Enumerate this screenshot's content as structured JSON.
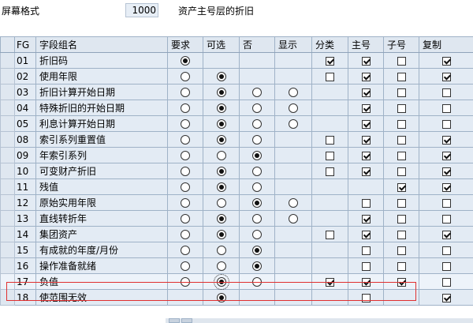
{
  "header": {
    "label": "屏幕格式",
    "value": "1000",
    "description": "资产主号层的折旧"
  },
  "columns": [
    "FG",
    "字段组名",
    "要求",
    "可选",
    "否",
    "显示",
    "分类",
    "主号",
    "子号",
    "复制"
  ],
  "rows": [
    {
      "fg": "01",
      "name": "折旧码",
      "radios": [
        "on",
        "",
        "",
        ""
      ],
      "checks": [
        "on",
        "on",
        "off",
        "on"
      ]
    },
    {
      "fg": "02",
      "name": "使用年限",
      "radios": [
        "off",
        "on",
        "",
        ""
      ],
      "checks": [
        "off",
        "on",
        "off",
        "on"
      ]
    },
    {
      "fg": "03",
      "name": "折旧计算开始日期",
      "radios": [
        "off",
        "on",
        "off",
        "off"
      ],
      "checks": [
        "",
        "on",
        "off",
        "off"
      ]
    },
    {
      "fg": "04",
      "name": "特殊折旧的开始日期",
      "radios": [
        "off",
        "on",
        "off",
        "off"
      ],
      "checks": [
        "",
        "on",
        "off",
        "off"
      ]
    },
    {
      "fg": "05",
      "name": "利息计算开始日期",
      "radios": [
        "off",
        "on",
        "off",
        "off"
      ],
      "checks": [
        "",
        "on",
        "off",
        "off"
      ]
    },
    {
      "fg": "08",
      "name": "索引系列重置值",
      "radios": [
        "off",
        "on",
        "off",
        ""
      ],
      "checks": [
        "off",
        "on",
        "off",
        "on"
      ]
    },
    {
      "fg": "09",
      "name": "年索引系列",
      "radios": [
        "off",
        "off",
        "on",
        ""
      ],
      "checks": [
        "off",
        "on",
        "off",
        "on"
      ]
    },
    {
      "fg": "10",
      "name": "可变财产折旧",
      "radios": [
        "off",
        "on",
        "off",
        ""
      ],
      "checks": [
        "off",
        "on",
        "off",
        "on"
      ]
    },
    {
      "fg": "11",
      "name": "残值",
      "radios": [
        "off",
        "on",
        "off",
        ""
      ],
      "checks": [
        "",
        "",
        "on",
        "on"
      ]
    },
    {
      "fg": "12",
      "name": "原始实用年限",
      "radios": [
        "off",
        "off",
        "on",
        "off"
      ],
      "checks": [
        "",
        "off",
        "off",
        "off"
      ]
    },
    {
      "fg": "13",
      "name": "直线转折年",
      "radios": [
        "off",
        "on",
        "off",
        "off"
      ],
      "checks": [
        "",
        "on",
        "off",
        "off"
      ]
    },
    {
      "fg": "14",
      "name": "集团资产",
      "radios": [
        "off",
        "on",
        "off",
        ""
      ],
      "checks": [
        "off",
        "on",
        "off",
        "on"
      ]
    },
    {
      "fg": "15",
      "name": "有成就的年度/月份",
      "radios": [
        "off",
        "off",
        "on",
        ""
      ],
      "checks": [
        "",
        "off",
        "off",
        "off"
      ]
    },
    {
      "fg": "16",
      "name": "操作准备就绪",
      "radios": [
        "off",
        "off",
        "on",
        ""
      ],
      "checks": [
        "",
        "off",
        "off",
        "off"
      ]
    },
    {
      "fg": "17",
      "name": "负值",
      "radios": [
        "off",
        "on",
        "off",
        ""
      ],
      "checks": [
        "on",
        "on",
        "on",
        "off"
      ]
    },
    {
      "fg": "18",
      "name": "使范围无效",
      "radios": [
        "",
        "on",
        "",
        ""
      ],
      "checks": [
        "",
        "off",
        "",
        "on"
      ]
    }
  ]
}
